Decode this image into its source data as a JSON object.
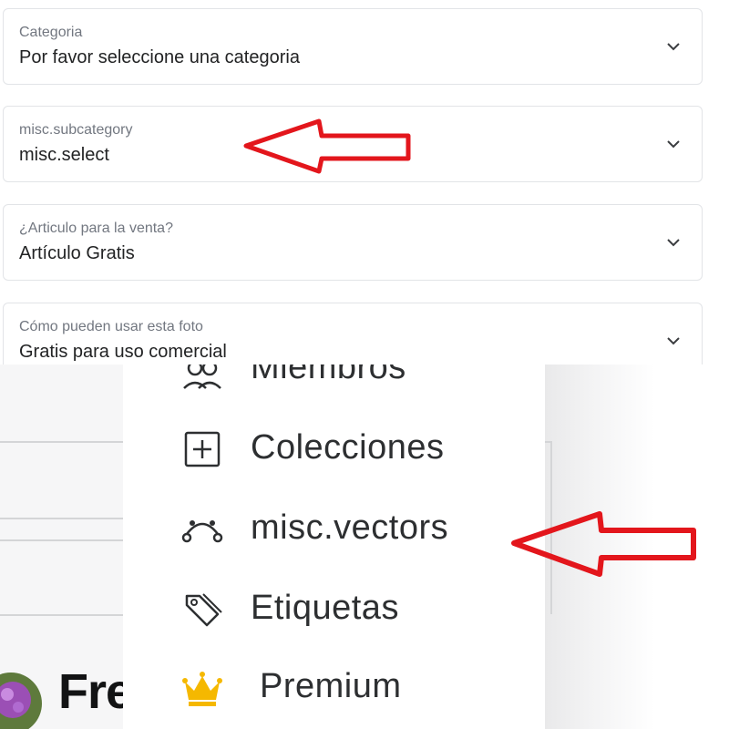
{
  "form": {
    "selects": [
      {
        "label": "Categoria",
        "value": "Por favor seleccione una categoria"
      },
      {
        "label": "misc.subcategory",
        "value": "misc.select"
      },
      {
        "label": "¿Articulo para la venta?",
        "value": "Artículo Gratis"
      },
      {
        "label": "Cómo pueden usar esta foto",
        "value": "Gratis para uso comercial"
      }
    ]
  },
  "menu": {
    "items": [
      {
        "label": "Miembros",
        "icon": "members-icon"
      },
      {
        "label": "Colecciones",
        "icon": "plus-square-icon"
      },
      {
        "label": "misc.vectors",
        "icon": "vector-path-icon"
      },
      {
        "label": "Etiquetas",
        "icon": "tag-icon"
      },
      {
        "label": "Premium",
        "icon": "crown-icon"
      }
    ]
  },
  "background": {
    "brand_fragment": "Fre"
  },
  "annotations": {
    "arrow_color": "#e3161c"
  },
  "colors": {
    "crown": "#f5b800",
    "text": "#2d2f31",
    "border": "#e2e4e7"
  }
}
